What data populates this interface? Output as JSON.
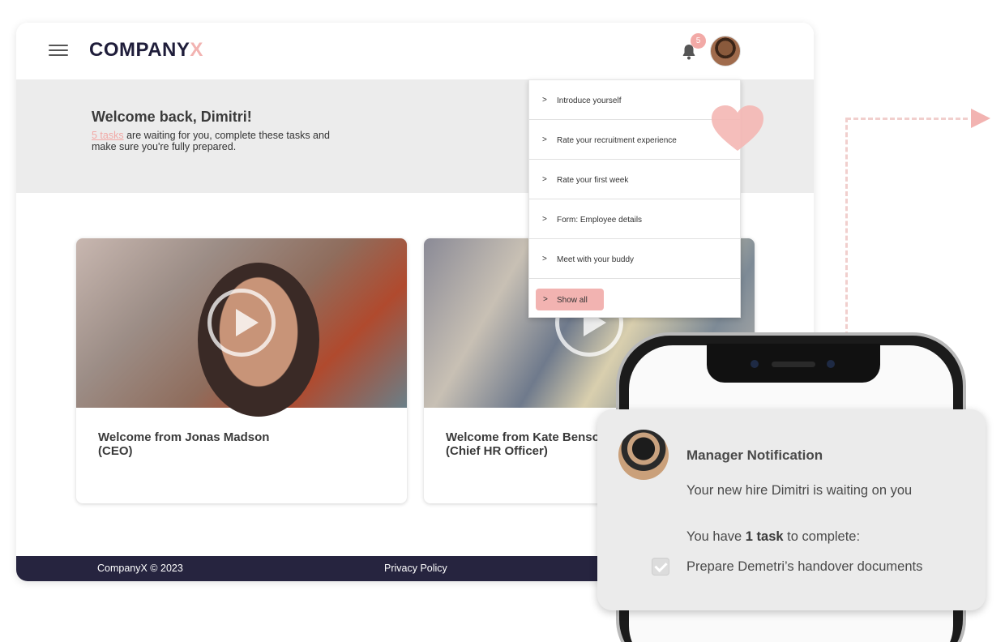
{
  "header": {
    "logo_main": "COMPANY",
    "logo_accent": "X",
    "notification_count": "5"
  },
  "hero": {
    "greeting": "Welcome back, Dimitri!",
    "tasks_link": "5 tasks",
    "subtitle": " are waiting for you, complete these tasks and make sure you're fully prepared."
  },
  "videos": [
    {
      "title": "Welcome from Jonas Madson (CEO)"
    },
    {
      "title": "Welcome from Kate Benson (Chief HR Officer)"
    }
  ],
  "tasks_dropdown": {
    "items": [
      {
        "label": "Introduce yourself"
      },
      {
        "label": "Rate your recruitment experience"
      },
      {
        "label": "Rate your first week"
      },
      {
        "label": "Form: Employee details"
      },
      {
        "label": "Meet with your buddy"
      }
    ],
    "show_all_label": "Show all",
    "chevron": ">"
  },
  "footer": {
    "copyright": "CompanyX © 2023",
    "privacy_label": "Privacy Policy"
  },
  "notification": {
    "title": "Manager Notification",
    "message": "Your new hire Dimitri is waiting on you",
    "task_prefix": "You have ",
    "task_count": "1 task",
    "task_suffix": " to complete:",
    "task_item": "Prepare Demetri’s handover documents",
    "task_checked": true
  },
  "colors": {
    "accent": "#f2b3b1",
    "footer_bg": "#26243f",
    "logo": "#1f1d3a"
  },
  "icons": {
    "menu": "hamburger-icon",
    "bell": "bell-icon",
    "play": "play-icon",
    "heart": "heart-icon",
    "check": "check-icon",
    "arrow": "arrow-right-icon"
  }
}
